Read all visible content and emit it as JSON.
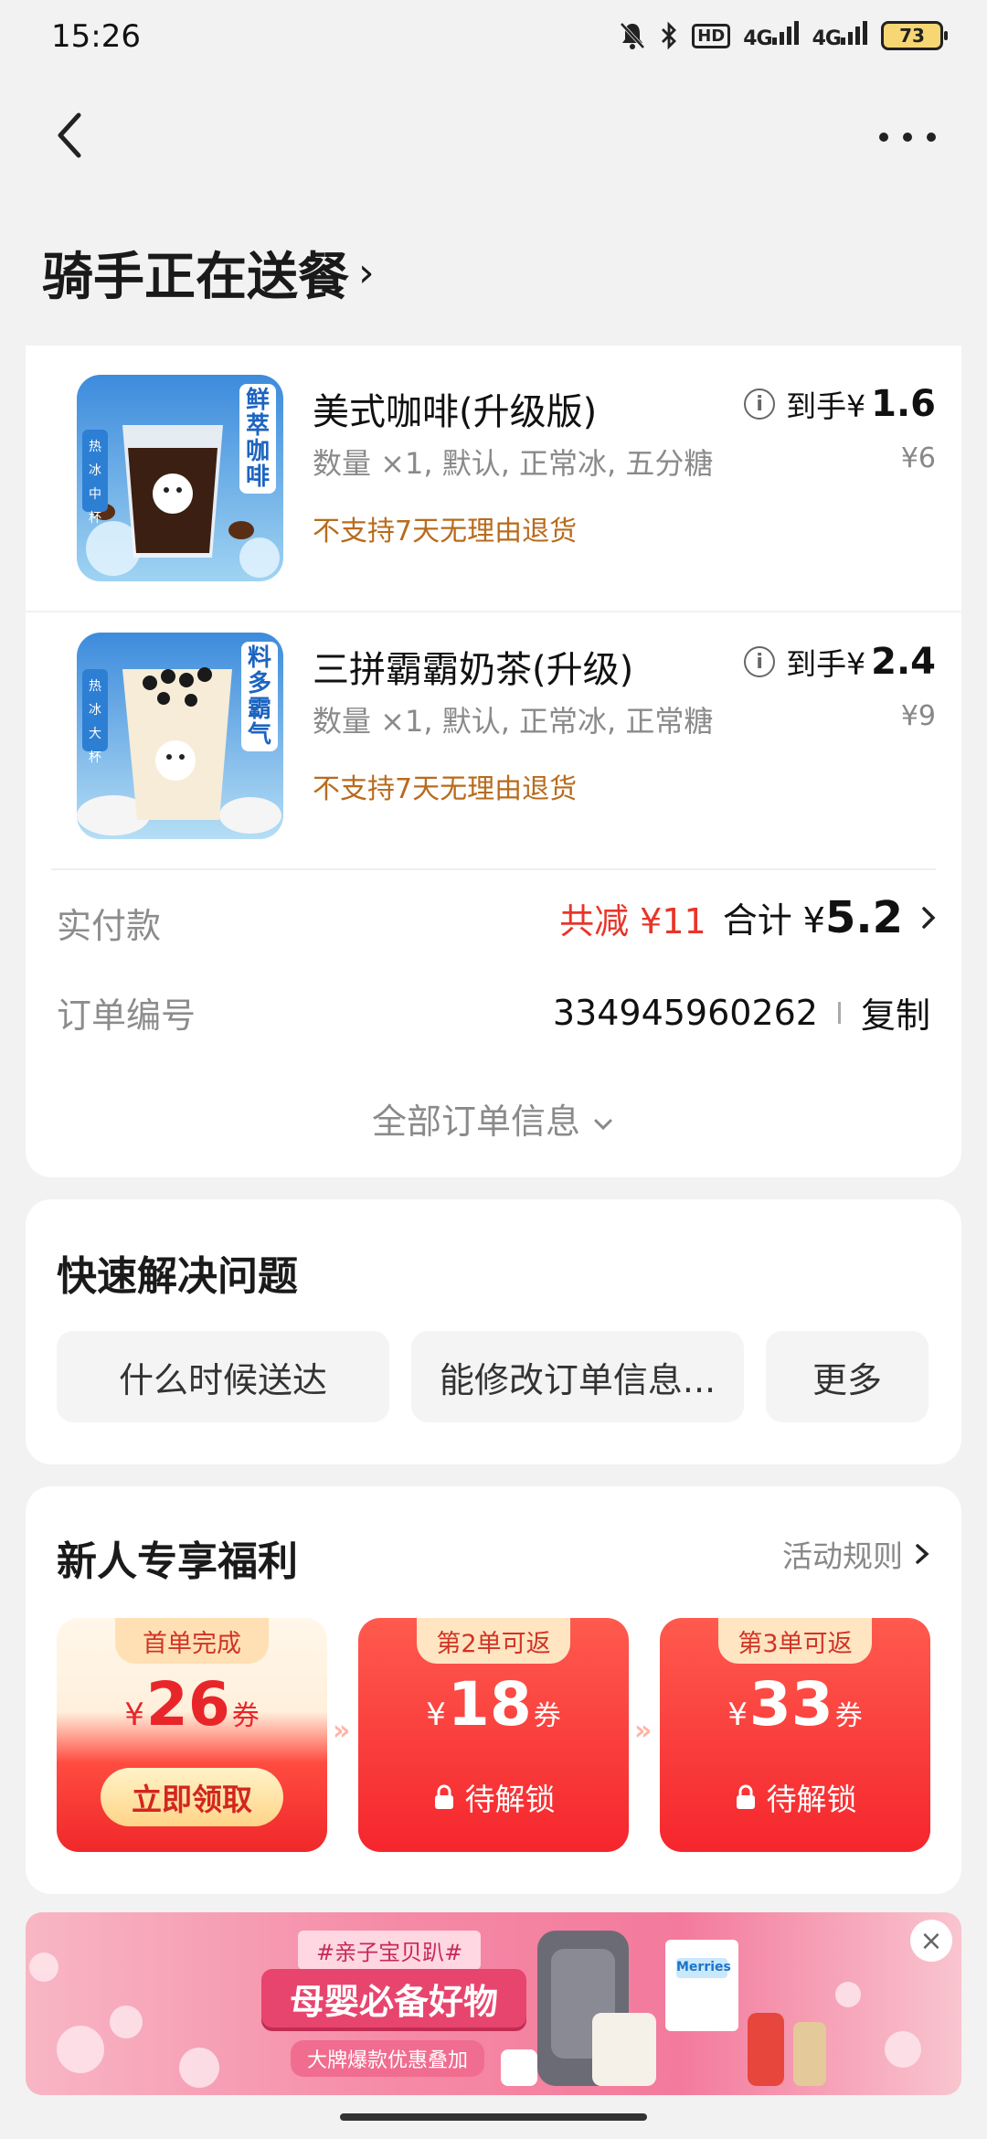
{
  "status_bar": {
    "time": "15:26",
    "hd_label": "HD",
    "signal1": "4G",
    "signal2": "4G",
    "battery": "73",
    "icons": [
      "mute-bell-icon",
      "bluetooth-icon",
      "hd-icon",
      "signal-icon",
      "signal-icon",
      "battery-icon"
    ]
  },
  "header": {
    "back_icon": "chevron-left-icon",
    "more_icon": "more-dots-icon",
    "title": "骑手正在送餐",
    "title_chevron": "›"
  },
  "order": {
    "items": [
      {
        "name": "美式咖啡(升级版)",
        "spec": "数量 ×1, 默认, 正常冰, 五分糖",
        "note": "不支持7天无理由退货",
        "final_prefix": "到手¥",
        "final_price": "1.6",
        "original_price": "¥6",
        "thumb_badge": "鲜萃咖啡",
        "thumb_tags": [
          "热",
          "冰",
          "中杯"
        ]
      },
      {
        "name": "三拼霸霸奶茶(升级)",
        "spec": "数量 ×1, 默认, 正常冰, 正常糖",
        "note": "不支持7天无理由退货",
        "final_prefix": "到手¥",
        "final_price": "2.4",
        "original_price": "¥9",
        "thumb_badge": "料多霸气",
        "thumb_tags": [
          "热",
          "冰",
          "大杯"
        ]
      }
    ],
    "paid_label": "实付款",
    "discount_text": "共减 ¥11",
    "total_label": "合计 ¥",
    "total_value": "5.2",
    "order_no_label": "订单编号",
    "order_no": "334945960262",
    "copy_label": "复制",
    "all_info_label": "全部订单信息"
  },
  "quick": {
    "title": "快速解决问题",
    "chips": [
      "什么时候送达",
      "能修改订单信息...",
      "更多"
    ]
  },
  "promo": {
    "title": "新人专享福利",
    "rules_label": "活动规则",
    "coupons": [
      {
        "tag": "首单完成",
        "yen": "¥",
        "amount": "26",
        "unit": "券",
        "action": "立即领取"
      },
      {
        "tag": "第2单可返",
        "yen": "¥",
        "amount": "18",
        "unit": "券",
        "action": "待解锁"
      },
      {
        "tag": "第3单可返",
        "yen": "¥",
        "amount": "33",
        "unit": "券",
        "action": "待解锁"
      }
    ],
    "arrow": "»"
  },
  "banner": {
    "tag": "#亲子宝贝趴#",
    "title": "母婴必备好物",
    "subtitle": "大牌爆款优惠叠加",
    "brand": "Merries",
    "close": "×"
  },
  "colors": {
    "accent_red": "#e8352a",
    "note_orange": "#b86b1c",
    "background": "#f2f2f2"
  }
}
